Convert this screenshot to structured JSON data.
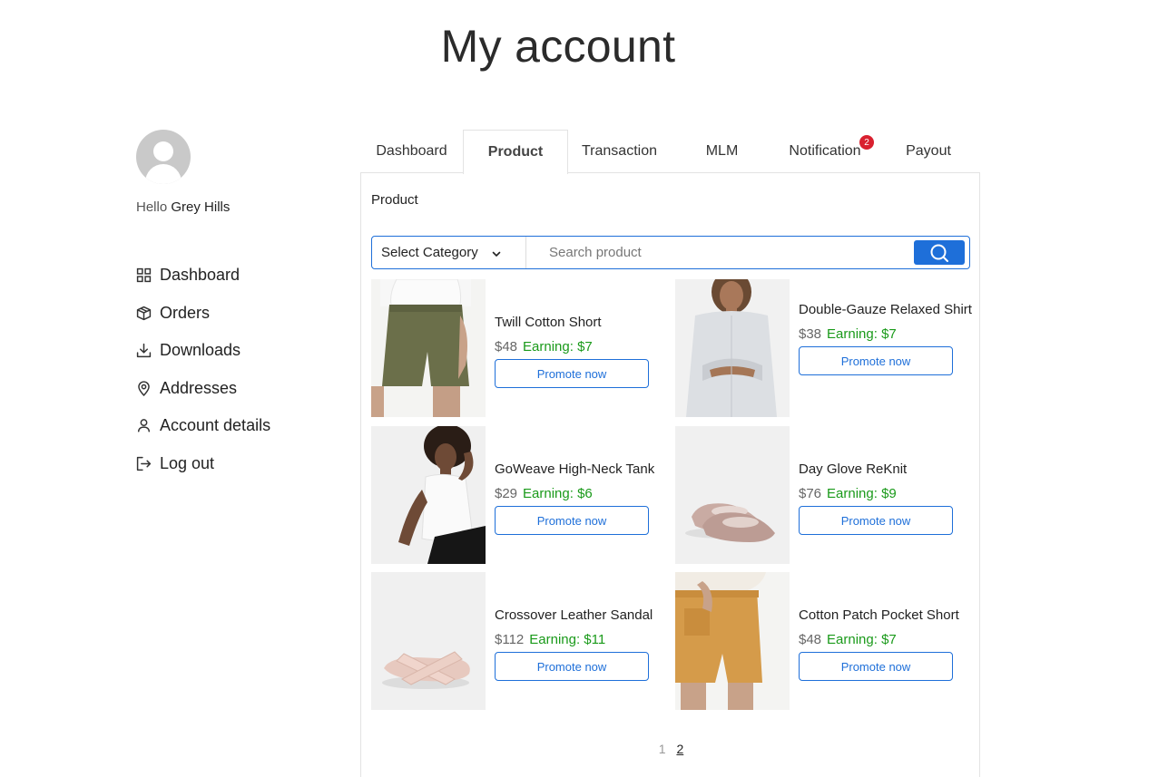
{
  "page": {
    "title": "My account"
  },
  "user": {
    "greeting": "Hello",
    "name": "Grey Hills"
  },
  "sidebar": {
    "items": [
      {
        "label": "Dashboard",
        "icon": "dashboard-grid-icon"
      },
      {
        "label": "Orders",
        "icon": "package-icon"
      },
      {
        "label": "Downloads",
        "icon": "download-icon"
      },
      {
        "label": "Addresses",
        "icon": "map-pin-icon"
      },
      {
        "label": "Account details",
        "icon": "user-icon"
      },
      {
        "label": "Log out",
        "icon": "logout-icon"
      }
    ]
  },
  "tabs": [
    {
      "label": "Dashboard",
      "active": false
    },
    {
      "label": "Product",
      "active": true
    },
    {
      "label": "Transaction",
      "active": false
    },
    {
      "label": "MLM",
      "active": false
    },
    {
      "label": "Notification",
      "active": false,
      "badge": "2"
    },
    {
      "label": "Payout",
      "active": false
    }
  ],
  "panel": {
    "title": "Product",
    "category_label": "Select Category",
    "search_placeholder": "Search product"
  },
  "products": [
    {
      "name": "Twill Cotton Short",
      "price": "$48",
      "earning": "Earning: $7",
      "button": "Promote now"
    },
    {
      "name": "Double-Gauze Relaxed Shirt",
      "price": "$38",
      "earning": "Earning: $7",
      "button": "Promote now"
    },
    {
      "name": "GoWeave High-Neck Tank",
      "price": "$29",
      "earning": "Earning: $6",
      "button": "Promote now"
    },
    {
      "name": "Day Glove ReKnit",
      "price": "$76",
      "earning": "Earning: $9",
      "button": "Promote now"
    },
    {
      "name": "Crossover Leather Sandal",
      "price": "$112",
      "earning": "Earning: $11",
      "button": "Promote now"
    },
    {
      "name": "Cotton Patch Pocket Short",
      "price": "$48",
      "earning": "Earning: $7",
      "button": "Promote now"
    }
  ],
  "pagination": {
    "current": "1",
    "next": "2"
  },
  "colors": {
    "accent": "#1e6fd9",
    "earning": "#1a9a1a",
    "badge": "#d9202f"
  }
}
